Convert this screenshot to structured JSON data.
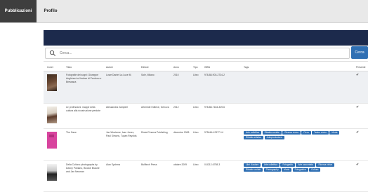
{
  "nav": {
    "tabs": [
      {
        "label": "Pubblicazioni",
        "active": true
      },
      {
        "label": "Profilo",
        "active": false
      }
    ]
  },
  "search": {
    "placeholder": "Cerca...",
    "button_label": "Cerca"
  },
  "table": {
    "headers": [
      "Cover",
      "Titolo",
      "Autore",
      "Editore",
      "Anno",
      "Tipo",
      "ISBN",
      "Tags",
      "Presente"
    ],
    "rows": [
      {
        "title": "Fotografie dei sogni: Giuseppe Anghinoni a Vedove di Perdono e Bressana",
        "author": "Lowe Daniel La Luce M.",
        "publisher": "Sole, Milano",
        "year": "2010",
        "type": "Libro",
        "isbn": "978-88-903-2734-2",
        "tags": [],
        "present": "✔"
      },
      {
        "title": "Le professioni: mappe della cultura alla ricostruzione perdute",
        "author": "Alessandra Zampieri",
        "publisher": "Artemide Editrice, Genova",
        "year": "2012",
        "type": "Libro",
        "isbn": "978-88-7184-349-6",
        "tags": [],
        "present": "✔"
      },
      {
        "title": "The Gaze",
        "author": "Jan Wouterse, Ivan Jones, Paul Simons, Tupan Reyolds",
        "publisher": "Distal Cinema Publishing",
        "year": "dicembre 2008",
        "type": "Libro",
        "isbn": "9754444-2377-14",
        "tags": [
          "Arte collettiva",
          "Ritratto sociale",
          "Ricerca visiva",
          "Fiera",
          "Teatro visivo",
          "Moda",
          "Ritratto artistico",
          "Autoproduzione"
        ],
        "present": "✔"
      },
      {
        "title": "Della Cultura: photographs by Danny Poblano, Brooke Braune and Jan Neuman",
        "author": "Alan Sychma",
        "publisher": "Bullfinch Press",
        "year": "ottobre 2009",
        "type": "Libro",
        "isbn": "0-8212-6758-3",
        "tags": [
          "Libri d'autore",
          "Arte collettiva",
          "Fotografia",
          "Arte raccontata",
          "Ricerca visiva",
          "Ritratto sociale",
          "Photography",
          "Moda",
          "Fotografica",
          "Cultura"
        ],
        "present": "✔"
      }
    ]
  },
  "colors": {
    "nav_active": "#3e3e3e",
    "dark_bar": "#1c2a4c",
    "button": "#2f6fb3",
    "tag": "#2f6fb3"
  },
  "icons": {
    "search": "magnifier"
  }
}
